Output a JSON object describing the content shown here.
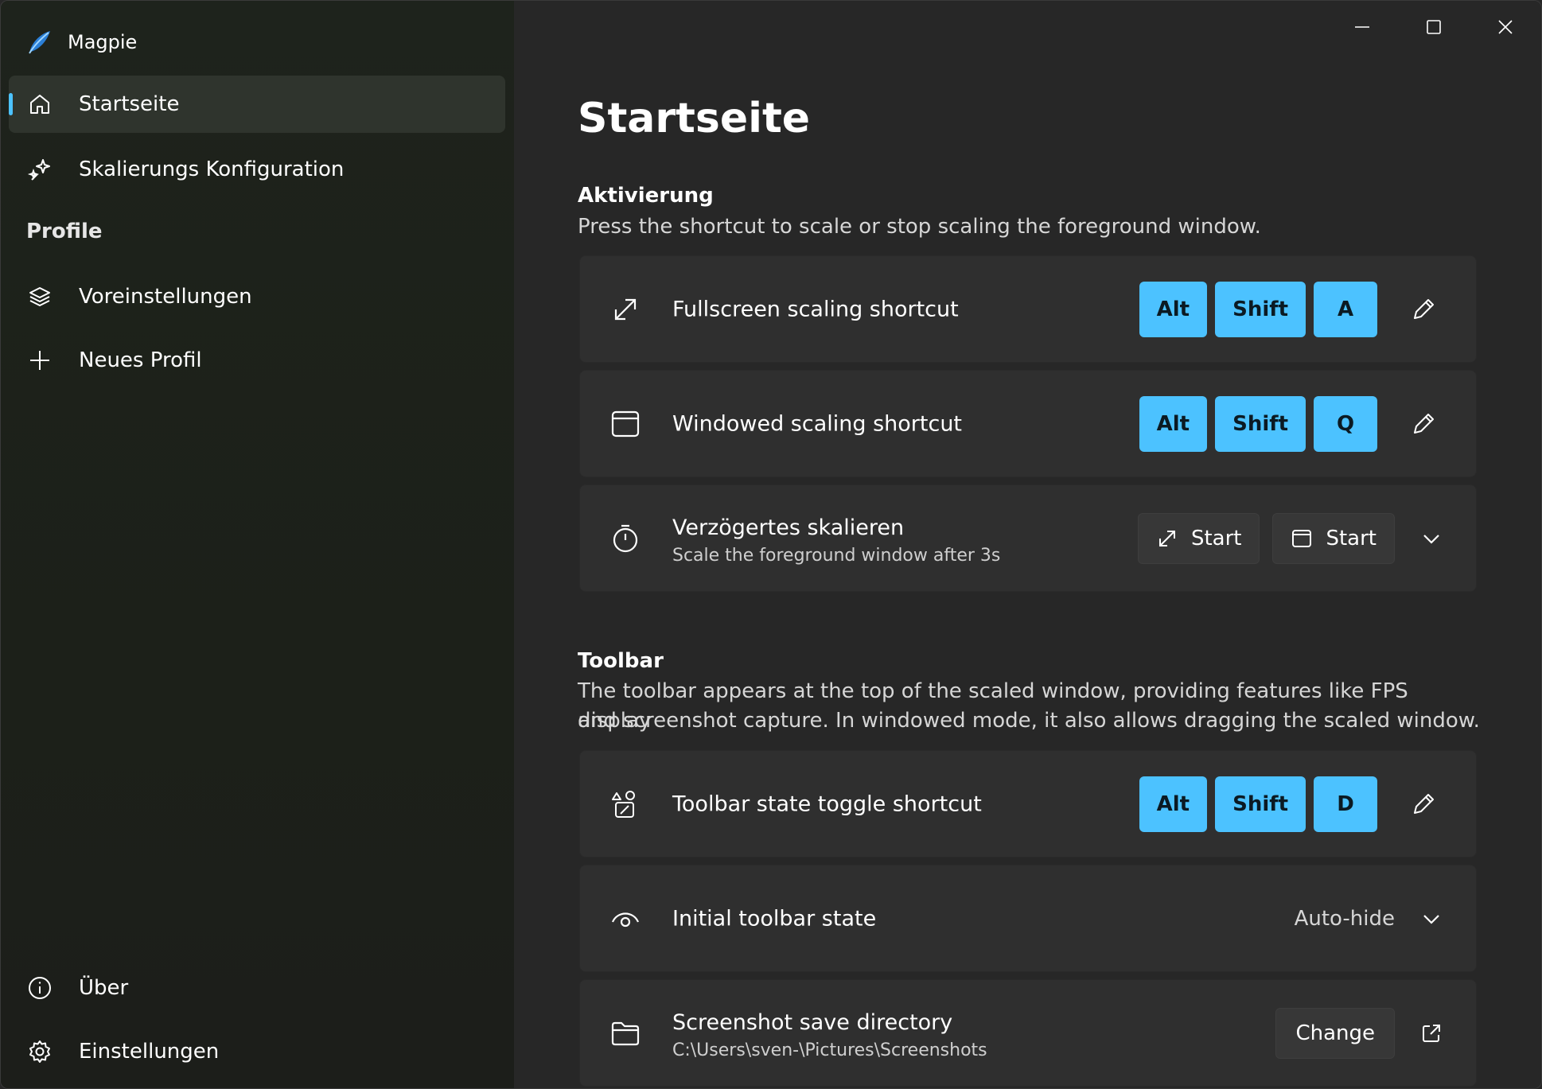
{
  "app": {
    "title": "Magpie"
  },
  "sidebar": {
    "items": [
      {
        "label": "Startseite",
        "icon": "home-icon",
        "active": true
      },
      {
        "label": "Skalierungs Konfiguration",
        "icon": "sparkle-icon"
      }
    ],
    "profiles_header": "Profile",
    "profiles": [
      {
        "label": "Voreinstellungen",
        "icon": "layers-icon"
      },
      {
        "label": "Neues Profil",
        "icon": "plus-icon"
      }
    ],
    "footer": [
      {
        "label": "Über",
        "icon": "info-icon"
      },
      {
        "label": "Einstellungen",
        "icon": "gear-icon"
      }
    ]
  },
  "page": {
    "title": "Startseite"
  },
  "activation": {
    "title": "Aktivierung",
    "description": "Press the shortcut to scale or stop scaling the foreground window.",
    "fullscreen": {
      "label": "Fullscreen scaling shortcut",
      "keys": [
        "Alt",
        "Shift",
        "A"
      ]
    },
    "windowed": {
      "label": "Windowed scaling shortcut",
      "keys": [
        "Alt",
        "Shift",
        "Q"
      ]
    },
    "delayed": {
      "label": "Verzögertes skalieren",
      "sublabel": "Scale the foreground window after 3s",
      "fullscreen_start": "Start",
      "windowed_start": "Start"
    }
  },
  "toolbar": {
    "title": "Toolbar",
    "description_line1": "The toolbar appears at the top of the scaled window, providing features like FPS display",
    "description_line2": "and screenshot capture. In windowed mode, it also allows dragging the scaled window.",
    "toggle": {
      "label": "Toolbar state toggle shortcut",
      "keys": [
        "Alt",
        "Shift",
        "D"
      ]
    },
    "initial_state": {
      "label": "Initial toolbar state",
      "value": "Auto-hide"
    },
    "screenshot_dir": {
      "label": "Screenshot save directory",
      "path": "C:\\Users\\sven-\\Pictures\\Screenshots",
      "change_label": "Change"
    }
  },
  "colors": {
    "accent": "#4cc2ff",
    "card": "#2f2f2f",
    "background": "#272727",
    "sidebar": "#1e231c"
  }
}
